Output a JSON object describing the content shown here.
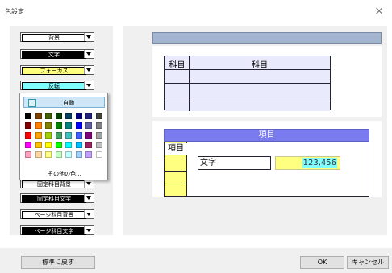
{
  "window": {
    "title": "色設定",
    "close_glyph": "×"
  },
  "combos": [
    {
      "label": "背景",
      "bg": "#ffffff",
      "fg": "#000000"
    },
    {
      "label": "文字",
      "bg": "#000000",
      "fg": "#ffffff"
    },
    {
      "label": "フォーカス",
      "bg": "#ffff80",
      "fg": "#000000"
    },
    {
      "label": "反転",
      "bg": "#80ffff",
      "fg": "#000000"
    },
    {
      "label": "固定科目背景",
      "bg": "#ffffff",
      "fg": "#000000"
    },
    {
      "label": "固定科目文字",
      "bg": "#000000",
      "fg": "#ffffff"
    },
    {
      "label": "ページ科目背景",
      "bg": "#ffffff",
      "fg": "#000000"
    },
    {
      "label": "ページ科目文字",
      "bg": "#000000",
      "fg": "#ffffff"
    }
  ],
  "palette": {
    "auto_label": "自動",
    "other_label": "その他の色...",
    "colors": [
      "#000000",
      "#804000",
      "#406000",
      "#004000",
      "#004060",
      "#000080",
      "#202080",
      "#404040",
      "#800000",
      "#ff8000",
      "#808000",
      "#008000",
      "#008080",
      "#0000ff",
      "#6060a0",
      "#808080",
      "#ff0000",
      "#ffa000",
      "#a0d000",
      "#40a060",
      "#40c0c0",
      "#4060ff",
      "#800080",
      "#a0a0a0",
      "#ff00ff",
      "#ffc000",
      "#ffff00",
      "#00ff00",
      "#00ffff",
      "#00c0ff",
      "#a02060",
      "#c0c0c0",
      "#ffa0c0",
      "#ffd8a0",
      "#ffff80",
      "#c0ffc0",
      "#c0ffff",
      "#a0d0ff",
      "#c0a0ff",
      "#ffffff"
    ]
  },
  "preview": {
    "table1": {
      "col1_header": "科目",
      "col2_header": "科目"
    },
    "table2": {
      "header": "項目",
      "row_header": "項目",
      "text_sample": "文字",
      "number_sample": "123,456"
    }
  },
  "buttons": {
    "reset": "標準に戻す",
    "ok": "OK",
    "cancel": "キャンセル"
  }
}
